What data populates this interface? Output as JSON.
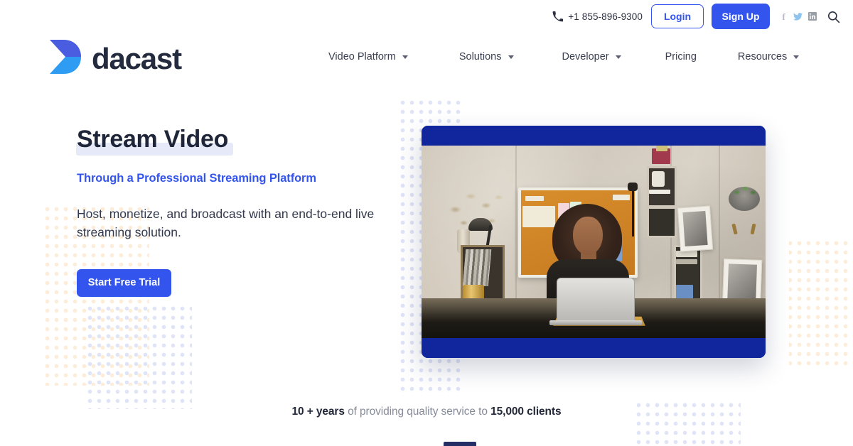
{
  "topbar": {
    "phone_icon": "phone-icon",
    "phone": "+1 855-896-9300",
    "login_label": "Login",
    "signup_label": "Sign Up",
    "socials": [
      {
        "name": "facebook-icon",
        "glyph": "f"
      },
      {
        "name": "twitter-icon",
        "glyph": ""
      },
      {
        "name": "linkedin-icon",
        "glyph": "in"
      }
    ],
    "search_icon": "search-icon"
  },
  "brand": {
    "name": "dacast",
    "logo_icon": "dacast-logo-icon",
    "logo_color_top": "#4a5ce0",
    "logo_color_bottom": "#2f9cf4",
    "wordmark_color": "#252b3f"
  },
  "nav": {
    "items": [
      {
        "label": "Video Platform",
        "has_dropdown": true
      },
      {
        "label": "Solutions",
        "has_dropdown": true
      },
      {
        "label": "Developer",
        "has_dropdown": true
      },
      {
        "label": "Pricing",
        "has_dropdown": false
      },
      {
        "label": "Resources",
        "has_dropdown": true
      }
    ]
  },
  "hero": {
    "heading": "Stream Video",
    "subheading": "Through a Professional Streaming Platform",
    "lede": "Host, monetize, and broadcast with an end-to-end live streaming solution.",
    "cta_label": "Start Free Trial",
    "accent_color": "#3355ee",
    "highlight_color": "#e6e9f7",
    "media": {
      "name": "hero-video-card",
      "frame_color": "#11269c",
      "alt": "Woman with curly hair smiling while working on a laptop in a home office with an orange corkboard, shelves and plants"
    }
  },
  "stats": {
    "lead": "10 + years",
    "middle": " of providing quality service to ",
    "trail": "15,000 clients"
  }
}
